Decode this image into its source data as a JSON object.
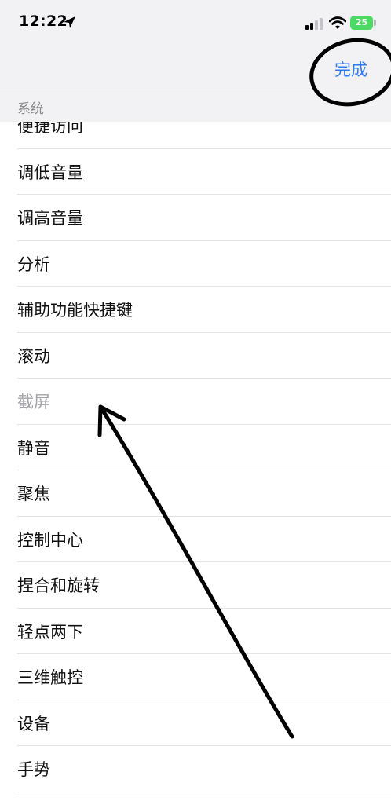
{
  "status_bar": {
    "time": "12:22",
    "battery": "25"
  },
  "header": {
    "done_label": "完成",
    "section_title": "系统"
  },
  "list": {
    "items": [
      {
        "label": "便捷访问",
        "enabled": true
      },
      {
        "label": "调低音量",
        "enabled": true
      },
      {
        "label": "调高音量",
        "enabled": true
      },
      {
        "label": "分析",
        "enabled": true
      },
      {
        "label": "辅助功能快捷键",
        "enabled": true
      },
      {
        "label": "滚动",
        "enabled": true
      },
      {
        "label": "截屏",
        "enabled": false
      },
      {
        "label": "静音",
        "enabled": true
      },
      {
        "label": "聚焦",
        "enabled": true
      },
      {
        "label": "控制中心",
        "enabled": true
      },
      {
        "label": "捏合和旋转",
        "enabled": true
      },
      {
        "label": "轻点两下",
        "enabled": true
      },
      {
        "label": "三维触控",
        "enabled": true
      },
      {
        "label": "设备",
        "enabled": true
      },
      {
        "label": "手势",
        "enabled": true
      }
    ]
  },
  "colors": {
    "accent": "#2f7bf5",
    "header_background": "#f2f2f4",
    "battery_green": "#4cd964",
    "disabled_text": "#a3a3a7"
  },
  "annotation": {
    "circle_target": "done-button",
    "arrow_target": "list-item-screenshot"
  }
}
